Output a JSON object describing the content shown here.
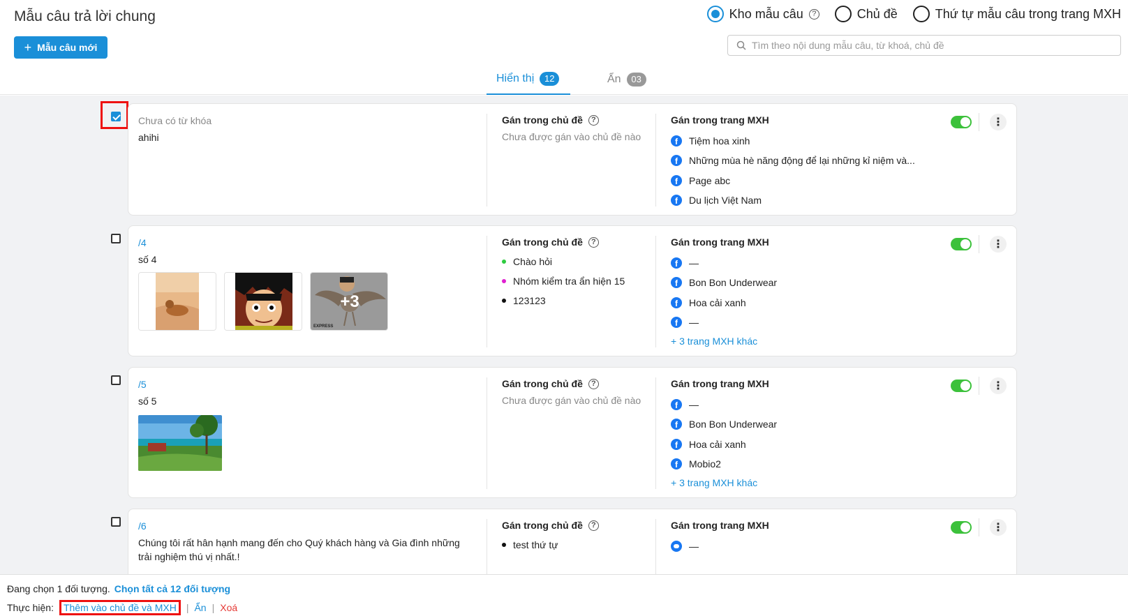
{
  "header": {
    "title": "Mẫu câu trả lời chung",
    "new_button": "Mẫu câu mới",
    "radios": [
      {
        "label": "Kho mẫu câu",
        "checked": true
      },
      {
        "label": "Chủ đề",
        "checked": false
      },
      {
        "label": "Thứ tự mẫu câu trong trang MXH",
        "checked": false
      }
    ],
    "search_placeholder": "Tìm theo nội dung mẫu câu, từ khoá, chủ đề"
  },
  "tabs": [
    {
      "label": "Hiển thị",
      "count": "12",
      "active": true
    },
    {
      "label": "Ẩn",
      "count": "03",
      "active": false
    }
  ],
  "column_titles": {
    "topic": "Gán trong chủ đề",
    "pages": "Gán trong trang MXH"
  },
  "cards": [
    {
      "checked": true,
      "keyword": "Chưa có từ khóa",
      "text": "ahihi",
      "topics_empty": "Chưa được gán vào chủ đề nào",
      "pages": [
        "Tiệm hoa xinh",
        "Những mùa hè năng động để lại những kỉ niệm và...",
        "Page abc",
        "Du lịch Việt Nam"
      ],
      "enabled": true
    },
    {
      "checked": false,
      "keyword": "/4",
      "text": "số 4",
      "image_more": "+3",
      "image_caption": "EXPRESS",
      "topics": [
        {
          "label": "Chào hỏi",
          "color": "#2ecc40"
        },
        {
          "label": "Nhóm kiểm tra ẩn hiện 15",
          "color": "#e020d0"
        },
        {
          "label": "123123",
          "color": "#111111"
        }
      ],
      "pages": [
        "—",
        "Bon Bon Underwear",
        "Hoa cải xanh",
        "—"
      ],
      "more_pages": "+ 3 trang MXH khác",
      "enabled": true
    },
    {
      "checked": false,
      "keyword": "/5",
      "text": "số 5",
      "topics_empty": "Chưa được gán vào chủ đề nào",
      "pages": [
        "—",
        "Bon Bon Underwear",
        "Hoa cải xanh",
        "Mobio2"
      ],
      "more_pages": "+ 3 trang MXH khác",
      "enabled": true
    },
    {
      "checked": false,
      "keyword": "/6",
      "text_line1": "Chúng tôi rất hân hạnh mang đến cho Quý khách hàng và Gia đình những",
      "text_line2": "trải nghiệm thú vị nhất.!",
      "topics": [
        {
          "label": "test thứ tự",
          "color": "#111111"
        }
      ],
      "pages": [
        "—"
      ],
      "enabled": true
    }
  ],
  "footer": {
    "selected_text": "Đang chọn 1 đối tượng.",
    "select_all": "Chọn tất cả 12 đối tượng",
    "action_label": "Thực hiện:",
    "action_add": "Thêm vào chủ đề và MXH",
    "action_hide": "Ẩn",
    "action_delete": "Xoá",
    "separator": "|"
  },
  "colors": {
    "accent": "#1a8fd8",
    "toggle_on": "#3cc13b",
    "danger": "#e53935",
    "highlight": "#ee1111"
  }
}
